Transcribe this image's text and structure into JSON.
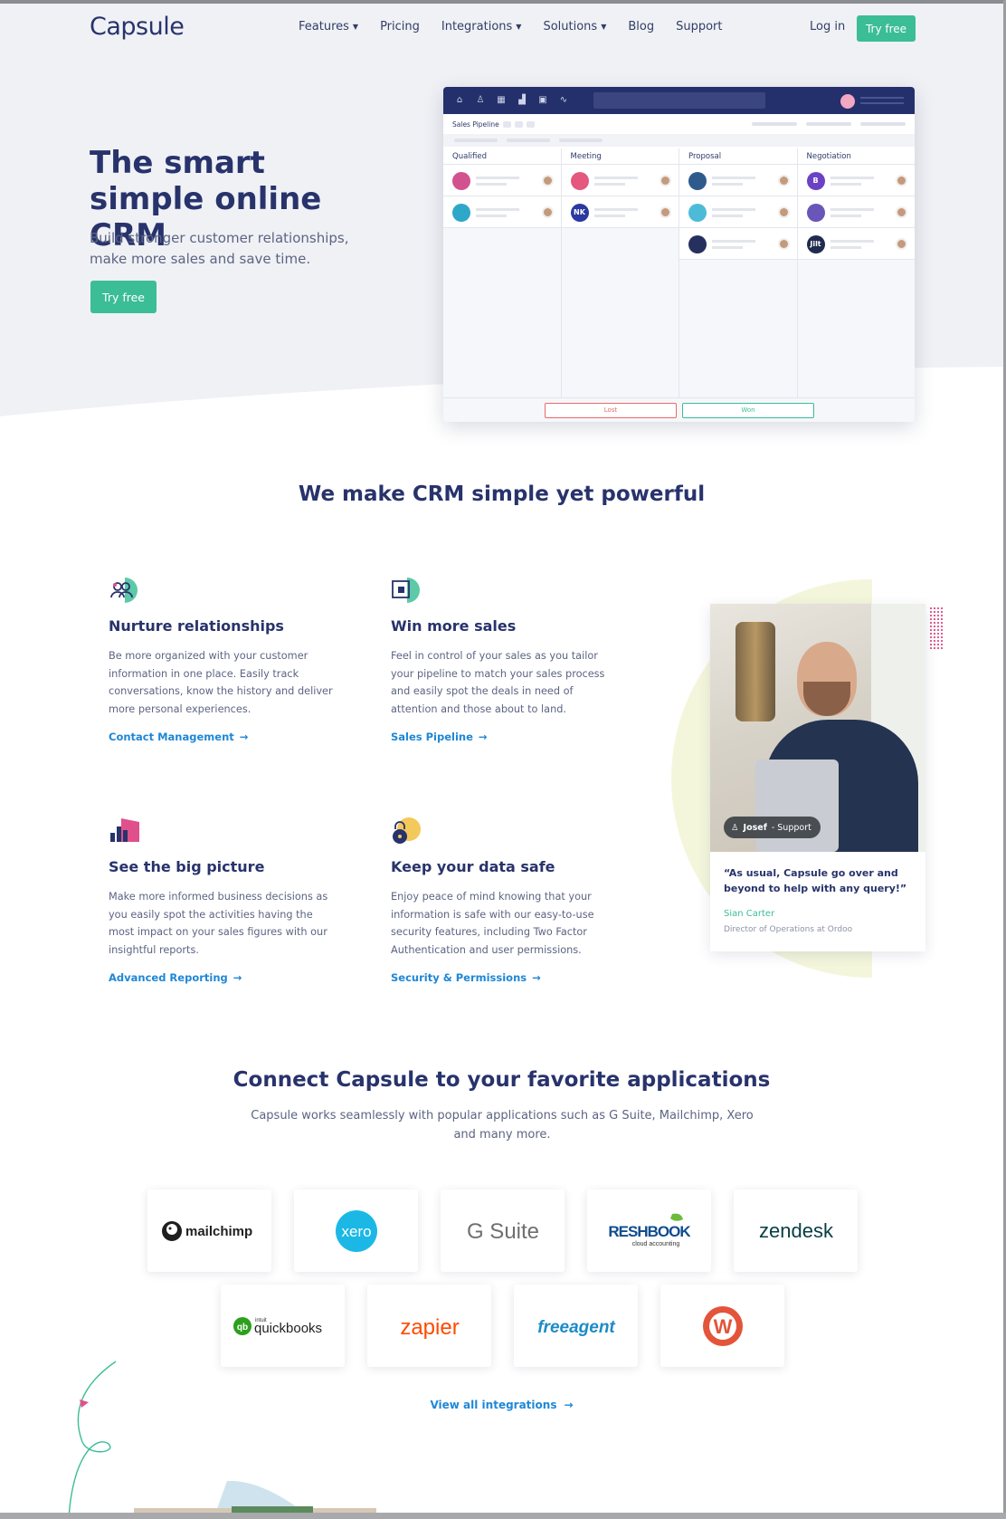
{
  "nav": {
    "logo": "Capsule",
    "items": [
      {
        "label": "Features",
        "dropdown": true
      },
      {
        "label": "Pricing",
        "dropdown": false
      },
      {
        "label": "Integrations",
        "dropdown": true
      },
      {
        "label": "Solutions",
        "dropdown": true
      },
      {
        "label": "Blog",
        "dropdown": false
      },
      {
        "label": "Support",
        "dropdown": false
      }
    ],
    "login": "Log in",
    "try_free": "Try free"
  },
  "hero": {
    "title": "The smart simple online CRM",
    "subtitle": "Build stronger customer relationships, make more sales and save time.",
    "cta": "Try free"
  },
  "pipeline": {
    "title": "Sales Pipeline",
    "columns": [
      {
        "name": "Qualified",
        "cards": [
          {
            "color": "#d1528f",
            "initials": ""
          },
          {
            "color": "#2fa7c9",
            "initials": ""
          }
        ]
      },
      {
        "name": "Meeting",
        "cards": [
          {
            "color": "#e4577f",
            "initials": ""
          },
          {
            "color": "#2a3aa0",
            "initials": "NK"
          }
        ]
      },
      {
        "name": "Proposal",
        "cards": [
          {
            "color": "#2f5a8c",
            "initials": ""
          },
          {
            "color": "#4dbbd8",
            "initials": ""
          },
          {
            "color": "#26305f",
            "initials": ""
          }
        ]
      },
      {
        "name": "Negotiation",
        "cards": [
          {
            "color": "#6b42c4",
            "initials": "B"
          },
          {
            "color": "#6a55b8",
            "initials": ""
          },
          {
            "color": "#1f2c4f",
            "initials": "Jilt"
          }
        ]
      }
    ],
    "lost": "Lost",
    "won": "Won"
  },
  "features_section": {
    "title": "We make CRM simple yet powerful",
    "items": [
      {
        "title": "Nurture relationships",
        "text": "Be more organized with your customer information in one place. Easily track conversations, know the history and deliver more personal experiences.",
        "link": "Contact Management",
        "icon": "people-icon"
      },
      {
        "title": "Win more sales",
        "text": "Feel in control of your sales as you tailor your pipeline to match your sales process and easily spot the deals in need of attention and those about to land.",
        "link": "Sales Pipeline",
        "icon": "pipeline-icon"
      },
      {
        "title": "See the big picture",
        "text": "Make more informed business decisions as you easily spot the activities having the most impact on your sales figures with our insightful reports.",
        "link": "Advanced Reporting",
        "icon": "bar-chart-icon"
      },
      {
        "title": "Keep your data safe",
        "text": "Enjoy peace of mind knowing that your information is safe with our easy-to-use security features, including Two Factor Authentication and user permissions.",
        "link": "Security & Permissions",
        "icon": "lock-icon"
      }
    ]
  },
  "testimonial": {
    "tag_name": "Josef",
    "tag_role": "- Support",
    "quote": "“As usual, Capsule go over and beyond to help with any query!”",
    "author": "Sian Carter",
    "author_title": "Director of Operations at Ordoo"
  },
  "integrations": {
    "title": "Connect Capsule to your favorite applications",
    "subtitle": "Capsule works seamlessly with popular applications such as G Suite, Mailchimp, Xero and many more.",
    "logos": [
      "mailchimp",
      "xero",
      "G Suite",
      "FRESHBOOKS",
      "cloud accounting",
      "zendesk",
      "intuit",
      "quickbooks",
      "zapier",
      "freeagent",
      "W"
    ],
    "view_all": "View all integrations"
  },
  "colors": {
    "navy": "#28336c",
    "green": "#3bbd96",
    "link_blue": "#1f87d6"
  }
}
